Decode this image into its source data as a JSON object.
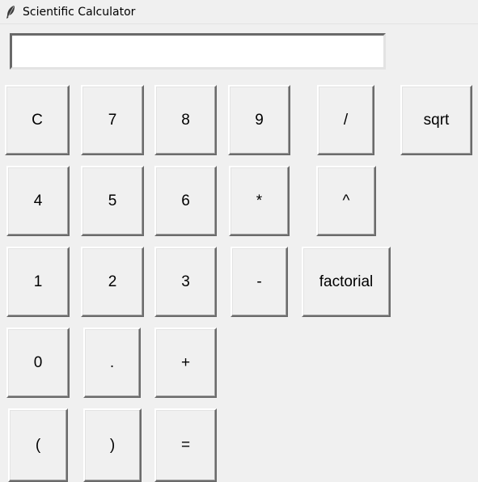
{
  "window": {
    "title": "Scientific Calculator",
    "icon": "feather-icon"
  },
  "display": {
    "value": ""
  },
  "buttons": {
    "clear": "C",
    "seven": "7",
    "eight": "8",
    "nine": "9",
    "divide": "/",
    "sqrt": "sqrt",
    "four": "4",
    "five": "5",
    "six": "6",
    "multiply": "*",
    "power": "^",
    "one": "1",
    "two": "2",
    "three": "3",
    "minus": "-",
    "factorial": "factorial",
    "zero": "0",
    "dot": ".",
    "plus": "+",
    "lparen": "(",
    "rparen": ")",
    "equals": "="
  }
}
